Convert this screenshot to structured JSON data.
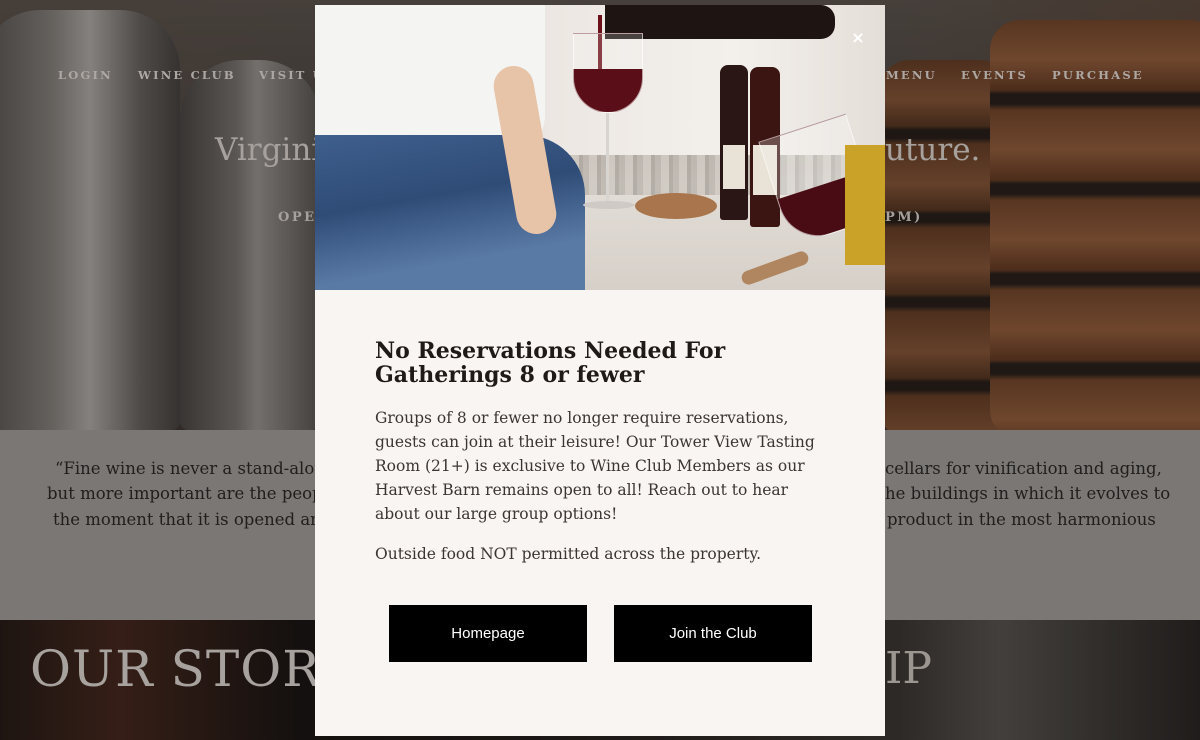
{
  "nav": {
    "items": [
      "LOGIN",
      "WINE CLUB",
      "VISIT U",
      "MENU",
      "EVENTS",
      "PURCHASE"
    ]
  },
  "hero": {
    "title_left": "Virgini",
    "title_right": "uture.",
    "sub_left": "OPE",
    "sub_right": "PM)"
  },
  "quote": {
    "left_lines": [
      "“Fine wine is never a stand-alone",
      "but more important are the peopl",
      "the moment that it is opened and"
    ],
    "right_lines": [
      "cellars for vinification and aging,",
      "he buildings in which it evolves to",
      "product in the most harmonious"
    ]
  },
  "sections": {
    "story_title": "OUR STORY",
    "right_title": "IP"
  },
  "modal": {
    "close_label": "×",
    "heading": "No Reservations Needed For Gatherings 8 or fewer",
    "body": "Groups of 8 or fewer no longer require reservations, guests can join at their leisure! Our Tower View Tasting Room (21+) is exclusive to Wine Club Members as our Harvest Barn remains open to all! Reach out to hear about our large group options!",
    "note": "Outside food NOT permitted across the property.",
    "buttons": {
      "homepage": "Homepage",
      "join": "Join the Club"
    }
  }
}
